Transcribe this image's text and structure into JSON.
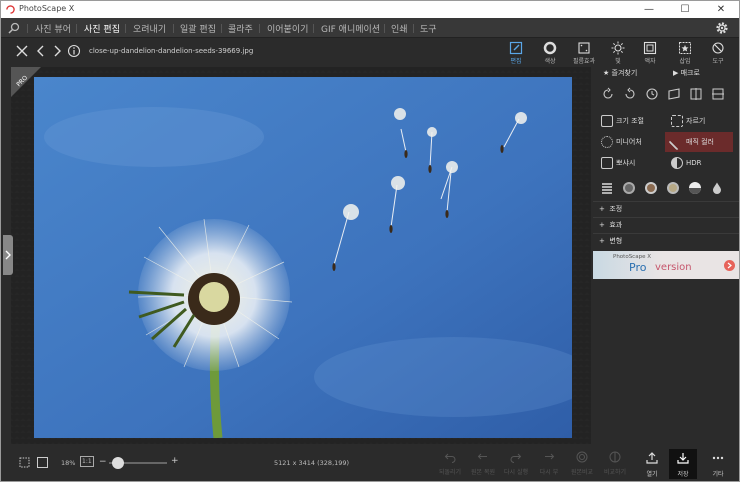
{
  "window": {
    "title": "PhotoScape X"
  },
  "menu": {
    "items": [
      "사진 뷰어",
      "사진 편집",
      "오려내기",
      "일괄 편집",
      "콜라주",
      "이어붙이기",
      "GIF 애니메이션",
      "인쇄",
      "도구"
    ],
    "active_index": 1
  },
  "toolbar": {
    "filename": "close-up-dandelion-dandelion-seeds-39669.jpg",
    "modes": [
      "편집",
      "색상",
      "필름효과",
      "빛",
      "액자",
      "삽입",
      "도구"
    ]
  },
  "side": {
    "tab_favorites": "즐겨찾기",
    "tab_macro": "매크로",
    "tools": [
      "크기 조절",
      "자르기",
      "미니어처",
      "매직 컬러",
      "뽀샤시",
      "HDR"
    ],
    "accordion": [
      "조정",
      "효과",
      "변형"
    ],
    "promo": {
      "brand": "PhotoScape X",
      "label_pro": "Pro",
      "label_version": "version"
    }
  },
  "bottom": {
    "zoom": "18%",
    "actual_size": "1:1",
    "minus": "−",
    "plus": "+",
    "status": "5121 x 3414 (328,199)",
    "history": [
      "되돌리기",
      "원본 복원",
      "다시 실행",
      "다시 부"
    ],
    "compare": [
      "원본비교",
      "비교하기"
    ],
    "actions": [
      "열기",
      "저장",
      "기타"
    ]
  },
  "colors": {
    "accent": "#5aa7e8",
    "highlight": "#6b2b2b",
    "sky": "#3f78c0"
  }
}
